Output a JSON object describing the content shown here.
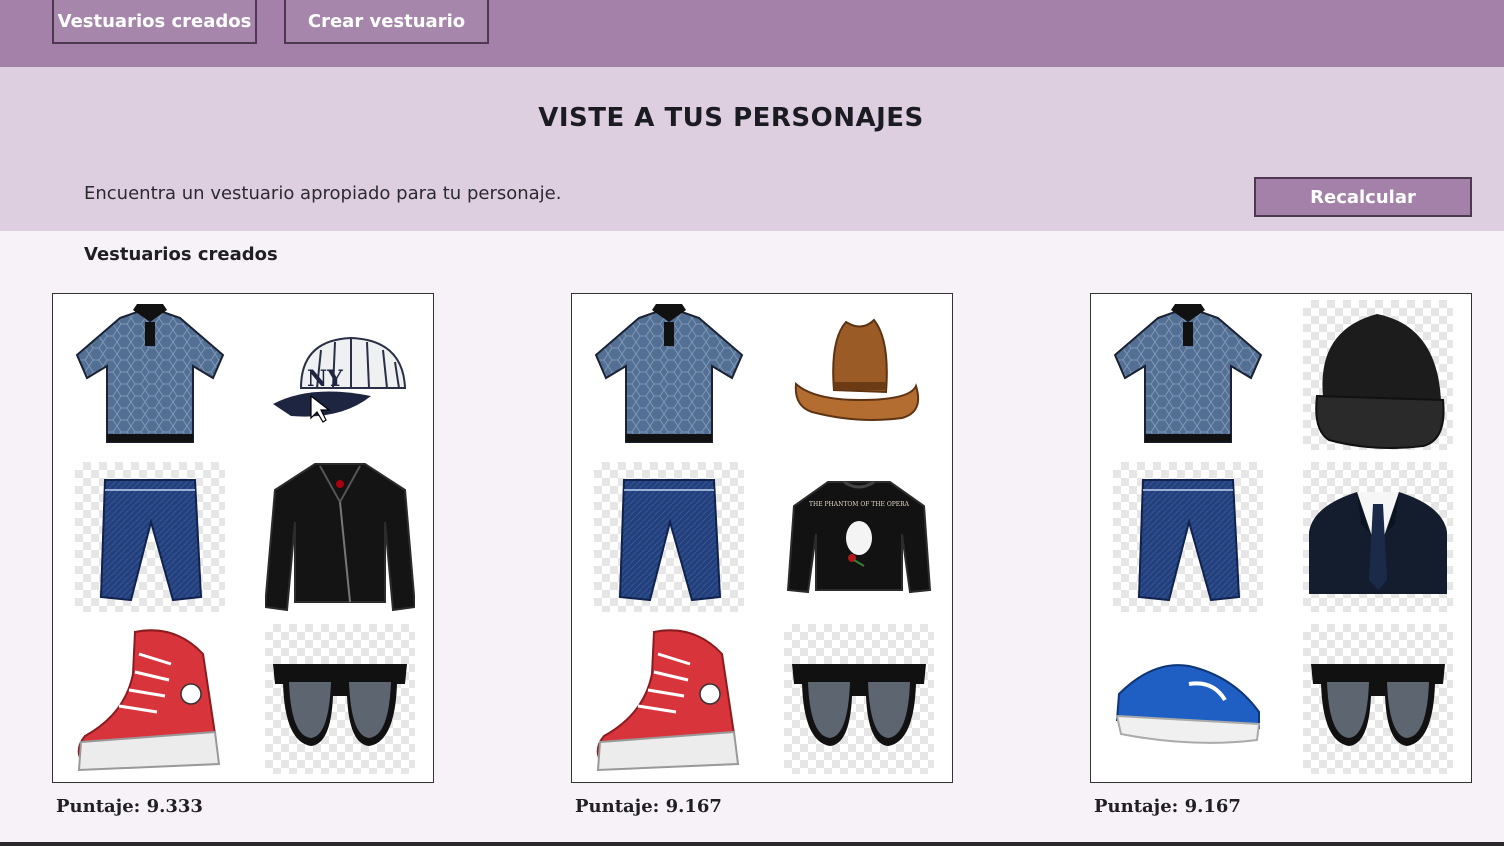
{
  "topbar": {
    "tabs": [
      {
        "label": "Vestuarios creados"
      },
      {
        "label": "Crear vestuario"
      }
    ]
  },
  "hero": {
    "title": "VISTE A TUS PERSONAJES",
    "subtitle": "Encuentra un vestuario apropiado para tu personaje.",
    "recalc_label": "Recalcular"
  },
  "section": {
    "label": "Vestuarios creados"
  },
  "outfits": [
    {
      "score_label": "Puntaje: 9.333",
      "items": [
        "polo-shirt-icon",
        "baseball-cap-icon",
        "jeans-icon",
        "leather-jacket-icon",
        "red-sneaker-icon",
        "sunglasses-icon"
      ]
    },
    {
      "score_label": "Puntaje: 9.167",
      "items": [
        "polo-shirt-icon",
        "cowboy-hat-icon",
        "jeans-icon",
        "sweatshirt-icon",
        "red-sneaker-icon",
        "sunglasses-icon"
      ],
      "sweatshirt_print": "THE PHANTOM OF THE OPERA"
    },
    {
      "score_label": "Puntaje: 9.167",
      "items": [
        "polo-shirt-icon",
        "beanie-icon",
        "jeans-icon",
        "suit-icon",
        "running-shoe-icon",
        "sunglasses-icon"
      ]
    }
  ],
  "colors": {
    "topbar": "#a381a8",
    "hero": "#ddcfe0",
    "page": "#f7f1f8",
    "button_border": "#4d3a50"
  }
}
